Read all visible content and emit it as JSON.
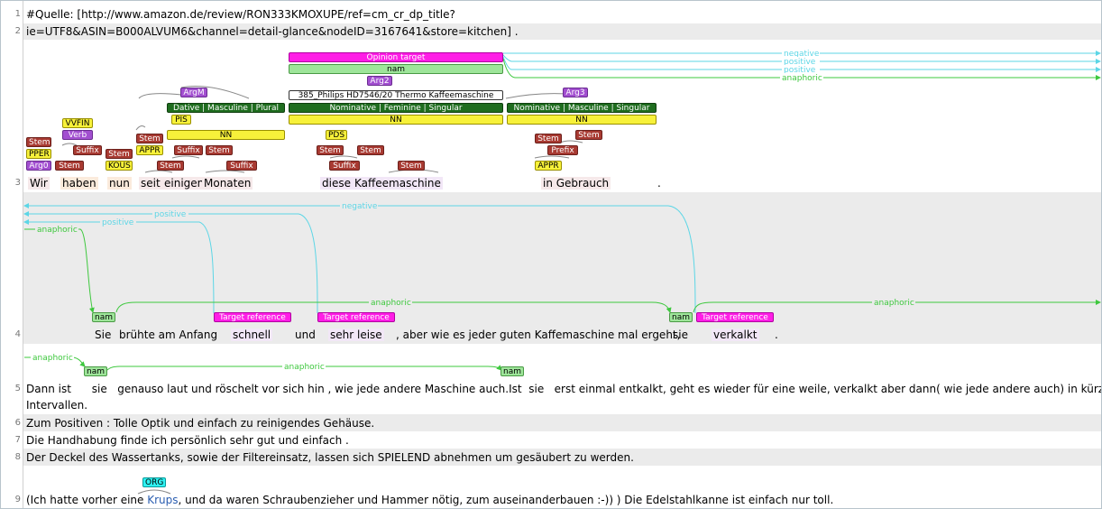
{
  "lines": [
    {
      "n": "1",
      "text": "#Quelle: [http://www.amazon.de/review/RON333KMOXUPE/ref=cm_cr_dp_title?"
    },
    {
      "n": "2",
      "text": "ie=UTF8&ASIN=B000ALVUM6&channel=detail-glance&nodeID=3167641&store=kitchen] ."
    },
    {
      "n": "3"
    },
    {
      "n": "4"
    },
    {
      "n": "5",
      "text": "Dann ist      sie   genauso laut und röschelt vor sich hin , wie jede andere Maschine auch.Ist  sie   erst einmal entkalkt, geht es wieder für eine weile, verkalkt aber dann( wie jede andere auch) in kürzeren",
      "text2": "Intervallen."
    },
    {
      "n": "6",
      "text": "Zum Positiven : Tolle Optik und einfach zu reinigendes Gehäuse."
    },
    {
      "n": "7",
      "text": "Die Handhabung finde ich persönlich sehr gut und einfach ."
    },
    {
      "n": "8",
      "text": "Der Deckel des Wassertanks, sowie der Filtereinsatz, lassen sich SPIELEND abnehmen um gesäubert zu werden."
    },
    {
      "n": "9",
      "text_before": "(Ich hatte vorher eine ",
      "krups": "Krups",
      "text_after": ", und da waren Schraubenzieher und Hammer nötig, zum auseinanderbauen :-)) ) Die Edelstahlkanne ist einfach nur toll."
    }
  ],
  "line3_tokens": {
    "wir": "Wir",
    "haben": "haben",
    "nun": "nun",
    "seit": "seit",
    "einigen": "einigen",
    "monaten": "Monaten",
    "diese": "diese",
    "kaffeemaschine": "Kaffeemaschine",
    "in_gebrauch": "in Gebrauch",
    "period": "."
  },
  "line4_tokens": {
    "sie1": "Sie",
    "bruehte": "brühte am Anfang",
    "schnell": "schnell",
    "und": "und",
    "sehr_leise": "sehr leise",
    "middle": ", aber wie es jeder guten Kaffemaschine mal ergeht,",
    "sie2": "sie",
    "verkalkt": "verkalkt",
    "period": "."
  },
  "labels": {
    "stem": "Stem",
    "suffix": "Suffix",
    "prefix": "Prefix",
    "pper": "PPER",
    "arg0": "Arg0",
    "vvfin": "VVFIN",
    "verb": "Verb",
    "kous": "KOUS",
    "appr": "APPR",
    "pis": "PIS",
    "nn": "NN",
    "pds": "PDS",
    "argm": "ArgM",
    "arg2": "Arg2",
    "arg3": "Arg3",
    "dative": "Dative | Masculine | Plural",
    "nominative_fem": "Nominative | Feminine | Singular",
    "nominative_masc": "Nominative | Masculine | Singular",
    "product": "385_Philips HD7546/20 Thermo Kaffeemaschine",
    "opinion_target": "Opinion target",
    "nam": "nam",
    "target_reference": "Target reference",
    "org": "ORG"
  },
  "arc_labels": {
    "negative": "negative",
    "positive": "positive",
    "anaphoric": "anaphoric"
  },
  "colors": {
    "arc_cyan": "#5cd6e6",
    "arc_green": "#3ec83e",
    "alt_row": "#ebebeb"
  }
}
